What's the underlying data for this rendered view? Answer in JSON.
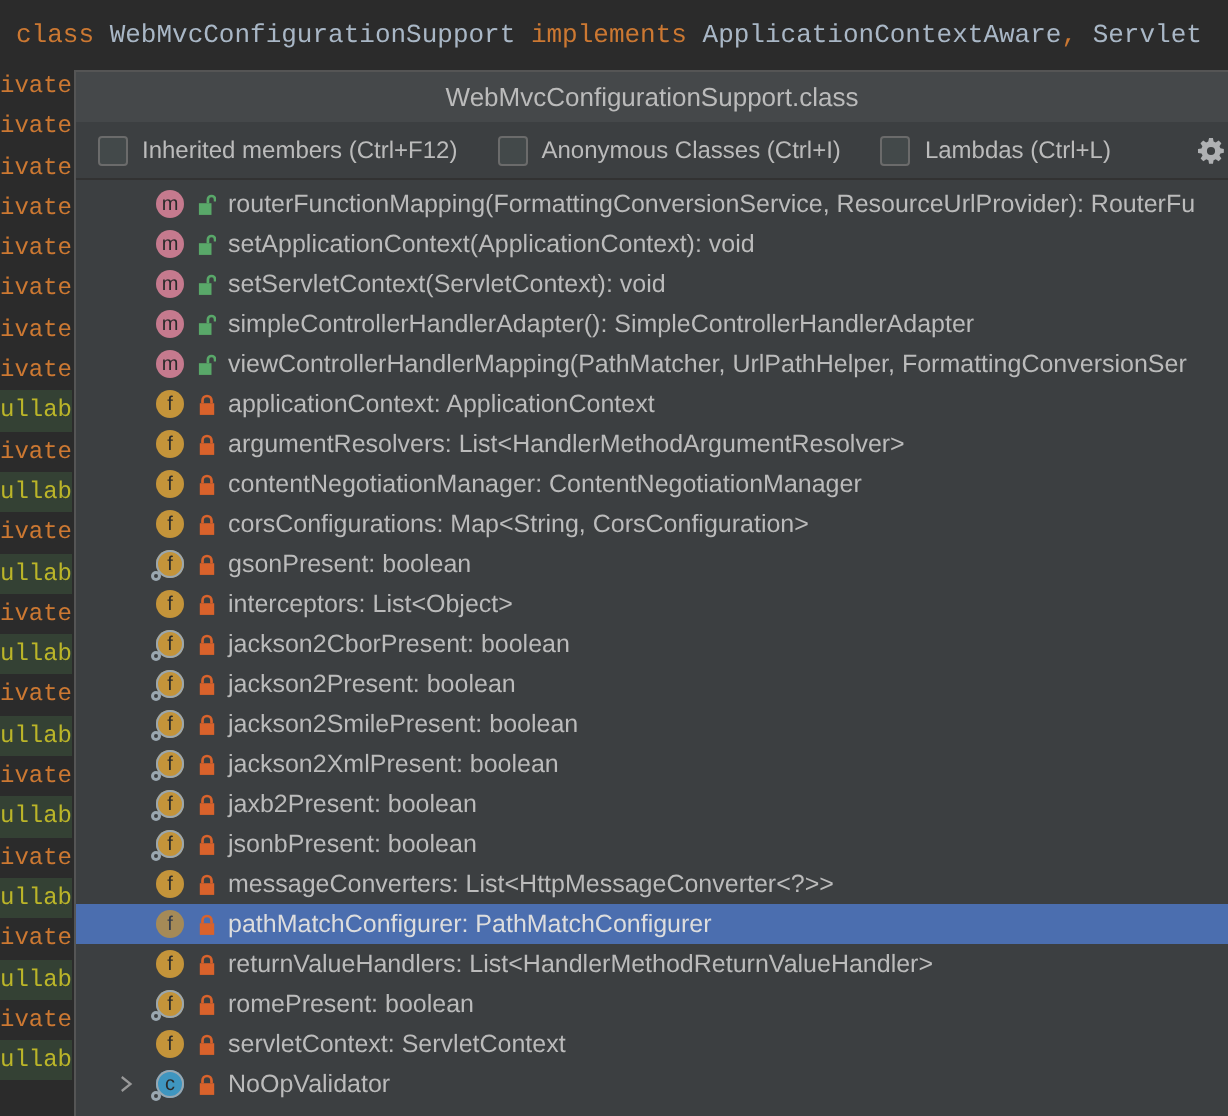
{
  "editor": {
    "header_line": [
      {
        "text": "class",
        "kind": "keyword"
      },
      {
        "text": " WebMvcConfigurationSupport ",
        "kind": "plain"
      },
      {
        "text": "implements",
        "kind": "keyword"
      },
      {
        "text": " ApplicationContextAware",
        "kind": "plain"
      },
      {
        "text": ",",
        "kind": "keyword"
      },
      {
        "text": " Servlet",
        "kind": "plain"
      }
    ],
    "lines": [
      {
        "text": "ivate",
        "kind": "keyword"
      },
      {
        "text": "ivate",
        "kind": "keyword"
      },
      {
        "text": "ivate",
        "kind": "keyword"
      },
      {
        "text": "ivate",
        "kind": "keyword"
      },
      {
        "text": "ivate",
        "kind": "keyword"
      },
      {
        "text": "ivate",
        "kind": "keyword"
      },
      {
        "text": "ivate",
        "kind": "keyword"
      },
      {
        "text": "ivate",
        "kind": "keyword"
      },
      {
        "text": "ullab",
        "kind": "annotation"
      },
      {
        "text": "ivate",
        "kind": "keyword"
      },
      {
        "text": "ullab",
        "kind": "annotation"
      },
      {
        "text": "ivate",
        "kind": "keyword"
      },
      {
        "text": "ullab",
        "kind": "annotation"
      },
      {
        "text": "ivate",
        "kind": "keyword"
      },
      {
        "text": "ullab",
        "kind": "annotation"
      },
      {
        "text": "ivate",
        "kind": "keyword"
      },
      {
        "text": "ullab",
        "kind": "annotation"
      },
      {
        "text": "ivate",
        "kind": "keyword"
      },
      {
        "text": "ullab",
        "kind": "annotation"
      },
      {
        "text": "ivate",
        "kind": "keyword"
      },
      {
        "text": "ullab",
        "kind": "annotation"
      },
      {
        "text": "ivate",
        "kind": "keyword"
      },
      {
        "text": "ullab",
        "kind": "annotation"
      },
      {
        "text": "ivate",
        "kind": "keyword"
      },
      {
        "text": "ullab",
        "kind": "annotation"
      }
    ]
  },
  "popup": {
    "title": "WebMvcConfigurationSupport.class",
    "options": [
      {
        "label": "Inherited members (Ctrl+F12)",
        "checked": false
      },
      {
        "label": "Anonymous Classes (Ctrl+I)",
        "checked": false
      },
      {
        "label": "Lambdas (Ctrl+L)",
        "checked": false
      }
    ],
    "members": [
      {
        "kind": "method",
        "badge": "m",
        "static": false,
        "locked": false,
        "label": "routerFunctionMapping(FormattingConversionService, ResourceUrlProvider): RouterFu",
        "selected": false
      },
      {
        "kind": "method",
        "badge": "m",
        "static": false,
        "locked": false,
        "label": "setApplicationContext(ApplicationContext): void",
        "selected": false
      },
      {
        "kind": "method",
        "badge": "m",
        "static": false,
        "locked": false,
        "label": "setServletContext(ServletContext): void",
        "selected": false
      },
      {
        "kind": "method",
        "badge": "m",
        "static": false,
        "locked": false,
        "label": "simpleControllerHandlerAdapter(): SimpleControllerHandlerAdapter",
        "selected": false
      },
      {
        "kind": "method",
        "badge": "m",
        "static": false,
        "locked": false,
        "label": "viewControllerHandlerMapping(PathMatcher, UrlPathHelper, FormattingConversionSer",
        "selected": false
      },
      {
        "kind": "field",
        "badge": "f",
        "static": false,
        "locked": true,
        "label": "applicationContext: ApplicationContext",
        "selected": false
      },
      {
        "kind": "field",
        "badge": "f",
        "static": false,
        "locked": true,
        "label": "argumentResolvers: List<HandlerMethodArgumentResolver>",
        "selected": false
      },
      {
        "kind": "field",
        "badge": "f",
        "static": false,
        "locked": true,
        "label": "contentNegotiationManager: ContentNegotiationManager",
        "selected": false
      },
      {
        "kind": "field",
        "badge": "f",
        "static": false,
        "locked": true,
        "label": "corsConfigurations: Map<String, CorsConfiguration>",
        "selected": false
      },
      {
        "kind": "field",
        "badge": "f",
        "static": true,
        "locked": true,
        "label": "gsonPresent: boolean",
        "selected": false
      },
      {
        "kind": "field",
        "badge": "f",
        "static": false,
        "locked": true,
        "label": "interceptors: List<Object>",
        "selected": false
      },
      {
        "kind": "field",
        "badge": "f",
        "static": true,
        "locked": true,
        "label": "jackson2CborPresent: boolean",
        "selected": false
      },
      {
        "kind": "field",
        "badge": "f",
        "static": true,
        "locked": true,
        "label": "jackson2Present: boolean",
        "selected": false
      },
      {
        "kind": "field",
        "badge": "f",
        "static": true,
        "locked": true,
        "label": "jackson2SmilePresent: boolean",
        "selected": false
      },
      {
        "kind": "field",
        "badge": "f",
        "static": true,
        "locked": true,
        "label": "jackson2XmlPresent: boolean",
        "selected": false
      },
      {
        "kind": "field",
        "badge": "f",
        "static": true,
        "locked": true,
        "label": "jaxb2Present: boolean",
        "selected": false
      },
      {
        "kind": "field",
        "badge": "f",
        "static": true,
        "locked": true,
        "label": "jsonbPresent: boolean",
        "selected": false
      },
      {
        "kind": "field",
        "badge": "f",
        "static": false,
        "locked": true,
        "label": "messageConverters: List<HttpMessageConverter<?>>",
        "selected": false
      },
      {
        "kind": "field",
        "badge": "f",
        "static": false,
        "locked": true,
        "label": "pathMatchConfigurer: PathMatchConfigurer",
        "selected": true
      },
      {
        "kind": "field",
        "badge": "f",
        "static": false,
        "locked": true,
        "label": "returnValueHandlers: List<HandlerMethodReturnValueHandler>",
        "selected": false
      },
      {
        "kind": "field",
        "badge": "f",
        "static": true,
        "locked": true,
        "label": "romePresent: boolean",
        "selected": false
      },
      {
        "kind": "field",
        "badge": "f",
        "static": false,
        "locked": true,
        "label": "servletContext: ServletContext",
        "selected": false
      },
      {
        "kind": "class",
        "badge": "c",
        "static": true,
        "locked": true,
        "label": "NoOpValidator",
        "selected": false,
        "expanded": false
      }
    ]
  }
}
